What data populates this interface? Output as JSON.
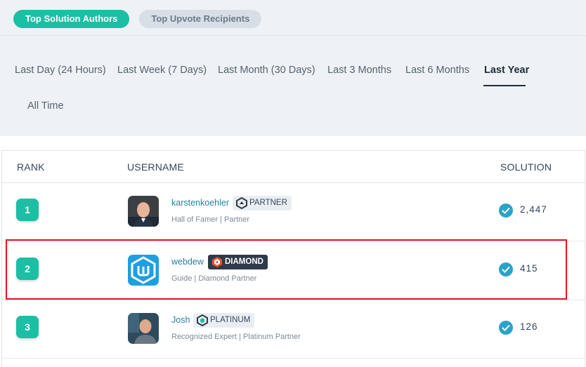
{
  "tabs": [
    {
      "label": "Top Solution Authors",
      "active": true
    },
    {
      "label": "Top Upvote Recipients",
      "active": false
    }
  ],
  "periods": {
    "day": "Last Day (24 Hours)",
    "week": "Last Week (7 Days)",
    "month": "Last Month (30 Days)",
    "three_months": "Last 3 Months",
    "six_months": "Last 6 Months",
    "year": "Last Year",
    "all": "All Time",
    "active": "Last Year"
  },
  "table": {
    "headers": {
      "rank": "RANK",
      "username": "USERNAME",
      "solution": "SOLUTION"
    },
    "rows": [
      {
        "rank": "1",
        "username": "karstenkoehler",
        "badge": "PARTNER",
        "subtitle": "Hall of Famer | Partner",
        "solutions": "2,447",
        "badge_icon": "partner-hexagon-icon"
      },
      {
        "rank": "2",
        "username": "webdew",
        "badge": "DIAMOND",
        "subtitle": "Guide | Diamond Partner",
        "solutions": "415",
        "badge_icon": "diamond-hexagon-icon"
      },
      {
        "rank": "3",
        "username": "Josh",
        "badge": "PLATINUM",
        "subtitle": "Recognized Expert | Platinum Partner",
        "solutions": "126",
        "badge_icon": "platinum-hexagon-icon"
      }
    ]
  },
  "colors": {
    "accent": "#1cbfa4",
    "link": "#2a7fa0",
    "check": "#2ba3c8",
    "highlight": "#e8131b",
    "panel": "#eef2f6"
  }
}
